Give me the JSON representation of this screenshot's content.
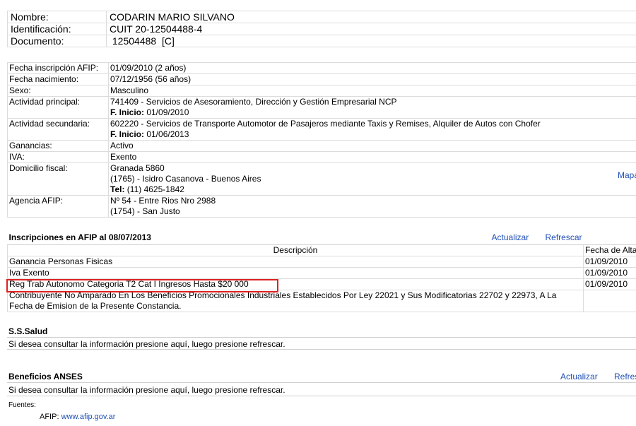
{
  "header": {
    "nombre_label": "Nombre:",
    "nombre_value": "CODARIN MARIO SILVANO",
    "ident_label": "Identificación:",
    "ident_value": "CUIT 20-12504488-4",
    "doc_label": "Documento:",
    "doc_value": " 12504488  [C]"
  },
  "details": {
    "fecha_insc_label": "Fecha inscripción AFIP:",
    "fecha_insc_value": "01/09/2010 (2 años)",
    "fecha_nac_label": "Fecha nacimiento:",
    "fecha_nac_value": "07/12/1956 (56 años)",
    "sexo_label": "Sexo:",
    "sexo_value": "Masculino",
    "act_pri_label": "Actividad principal:",
    "act_pri_value": "741409 - Servicios de Asesoramiento, Dirección y Gestión Empresarial NCP",
    "act_pri_inicio_label": "F. Inicio:",
    "act_pri_inicio_value": " 01/09/2010",
    "act_sec_label": "Actividad secundaria:",
    "act_sec_value": "602220 - Servicios de Transporte Automotor de Pasajeros mediante Taxis y Remises, Alquiler de Autos con Chofer",
    "act_sec_inicio_label": "F. Inicio:",
    "act_sec_inicio_value": " 01/06/2013",
    "ganancias_label": "Ganancias:",
    "ganancias_value": "Activo",
    "iva_label": "IVA:",
    "iva_value": "Exento",
    "domicilio_label": "Domicilio fiscal:",
    "domicilio_line1": "Granada 5860",
    "domicilio_line2": "(1765) - Isidro Casanova - Buenos Aires",
    "tel_label": "Tel:",
    "tel_value": " (11) 4625-1842",
    "mapa_link": "Mapa",
    "agencia_label": "Agencia AFIP:",
    "agencia_line1": "Nº 54 - Entre Rios Nro 2988",
    "agencia_line2": "(1754) - San Justo"
  },
  "inscripciones": {
    "title": "Inscripciones en AFIP al 08/07/2013",
    "actualizar": "Actualizar",
    "refrescar": "Refrescar",
    "col_desc": "Descripción",
    "col_fecha": "Fecha de Alta",
    "rows": [
      {
        "desc": "Ganancia Personas Fisicas",
        "fecha": "01/09/2010"
      },
      {
        "desc": "Iva Exento",
        "fecha": "01/09/2010"
      },
      {
        "desc": "Reg Trab Autonomo Categoria T2 Cat I Ingresos Hasta $20 000",
        "fecha": "01/09/2010"
      },
      {
        "desc": "Contribuyente No Amparado En Los Beneficios Promocionales Industriales Establecidos Por Ley 22021 y Sus Modificatorias 22702 y 22973, A La Fecha de Emision de la Presente Constancia.",
        "fecha": ""
      }
    ]
  },
  "salud": {
    "title": "S.S.Salud",
    "text": "Si desea consultar la información presione aquí, luego presione refrescar."
  },
  "anses": {
    "title": "Beneficios ANSES",
    "actualizar": "Actualizar",
    "refrescar": "Refrescar",
    "text": "Si desea consultar la información presione aquí, luego presione refrescar."
  },
  "fuentes": {
    "label": "Fuentes:",
    "afip_label": "AFIP:",
    "afip_link": "www.afip.gov.ar"
  },
  "colors": {
    "link": "#1f4fb5",
    "highlight": "#e02020",
    "border": "#dcdcdc"
  }
}
